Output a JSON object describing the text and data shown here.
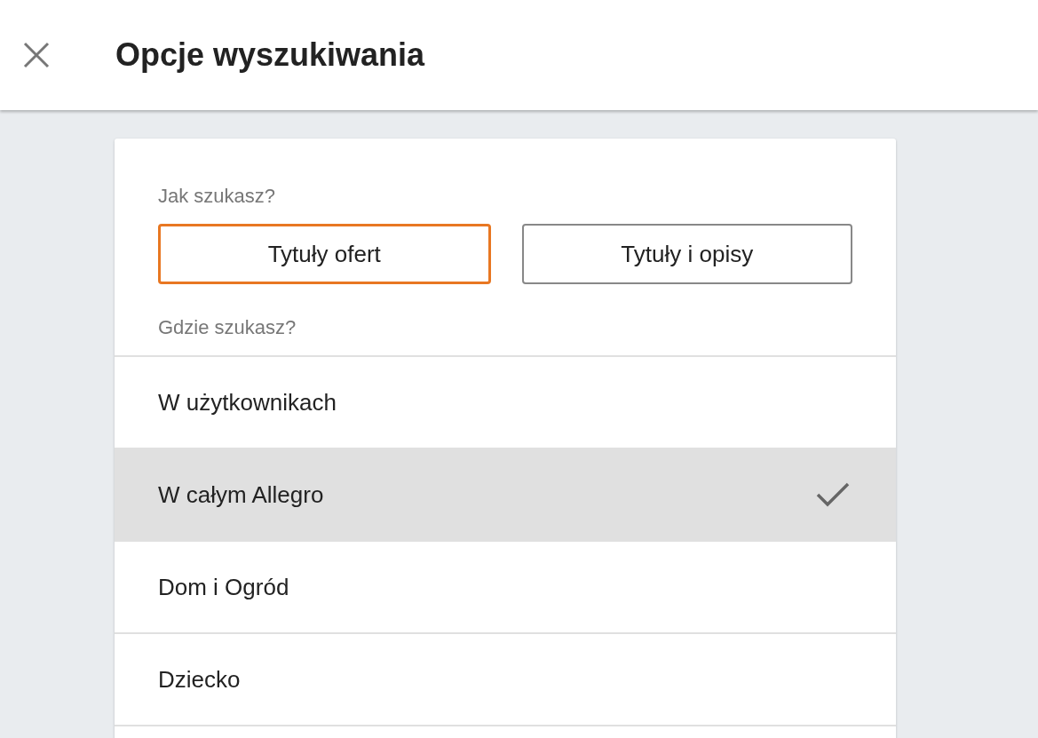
{
  "header": {
    "title": "Opcje wyszukiwania"
  },
  "search_mode": {
    "label": "Jak szukasz?",
    "options": [
      {
        "label": "Tytuły ofert",
        "selected": true
      },
      {
        "label": "Tytuły i opisy",
        "selected": false
      }
    ]
  },
  "scope": {
    "label": "Gdzie szukasz?",
    "items": [
      {
        "label": "W użytkownikach",
        "selected": false
      },
      {
        "label": "W całym Allegro",
        "selected": true
      },
      {
        "label": "Dom i Ogród",
        "selected": false
      },
      {
        "label": "Dziecko",
        "selected": false
      }
    ]
  }
}
